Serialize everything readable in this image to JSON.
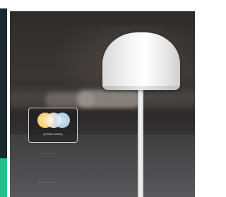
{
  "badge": {
    "label": "(2700K-5700K)"
  },
  "markers": {
    "dots_upper": "..........",
    "dots_lower": ".........."
  },
  "colors": {
    "backdrop": "#1b2a30",
    "accent": "#22c08a",
    "lamp": "#f4f4f4"
  }
}
